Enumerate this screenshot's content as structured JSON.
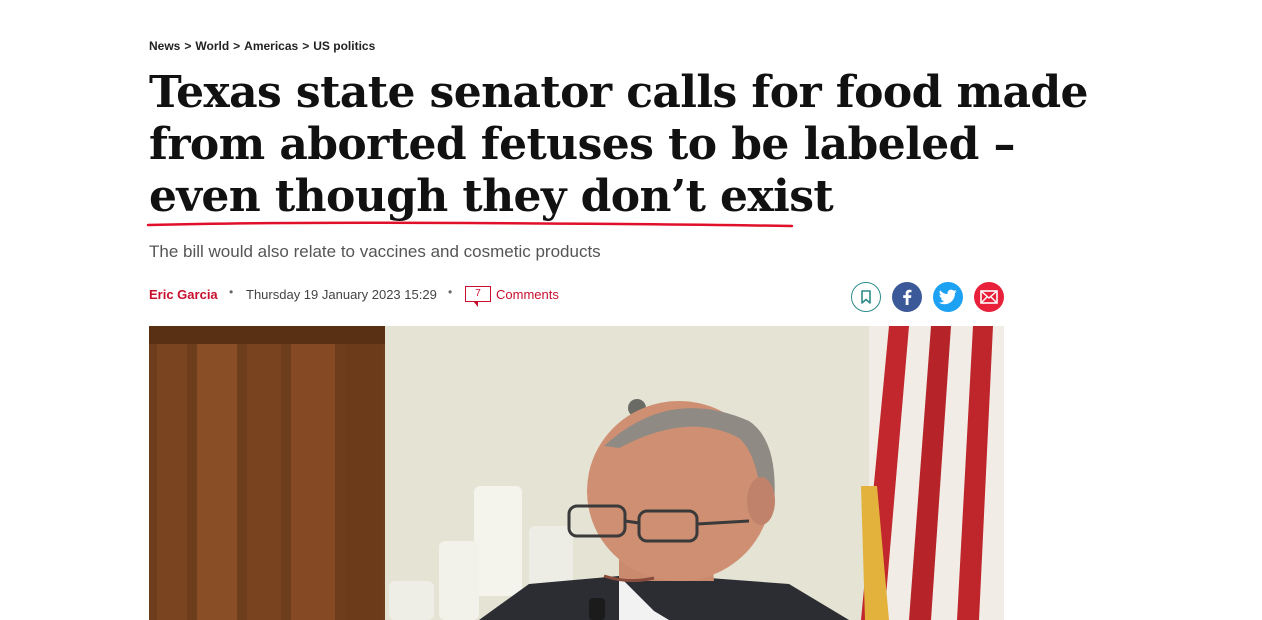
{
  "breadcrumb": [
    "News",
    "World",
    "Americas",
    "US politics"
  ],
  "breadcrumb_separator": ">",
  "headline": {
    "line1": "Texas state senator calls for food made",
    "line2": "from aborted fetuses to be labeled –",
    "line3": "even though they don’t exist"
  },
  "standfirst": "The bill would also relate to vaccines and cosmetic products",
  "meta": {
    "author": "Eric Garcia",
    "bullet": "•",
    "date": "Thursday 19 January 2023 15:29",
    "comment_count": "7",
    "comments_label": "Comments"
  },
  "share_icons": [
    "bookmark-icon",
    "facebook-icon",
    "twitter-icon",
    "email-icon"
  ],
  "colors": {
    "accent": "#c8102e",
    "underline": "#e0102a",
    "facebook": "#3b5998",
    "twitter": "#1da1f2",
    "email": "#e8203a",
    "bookmark": "#2e8b8b"
  }
}
